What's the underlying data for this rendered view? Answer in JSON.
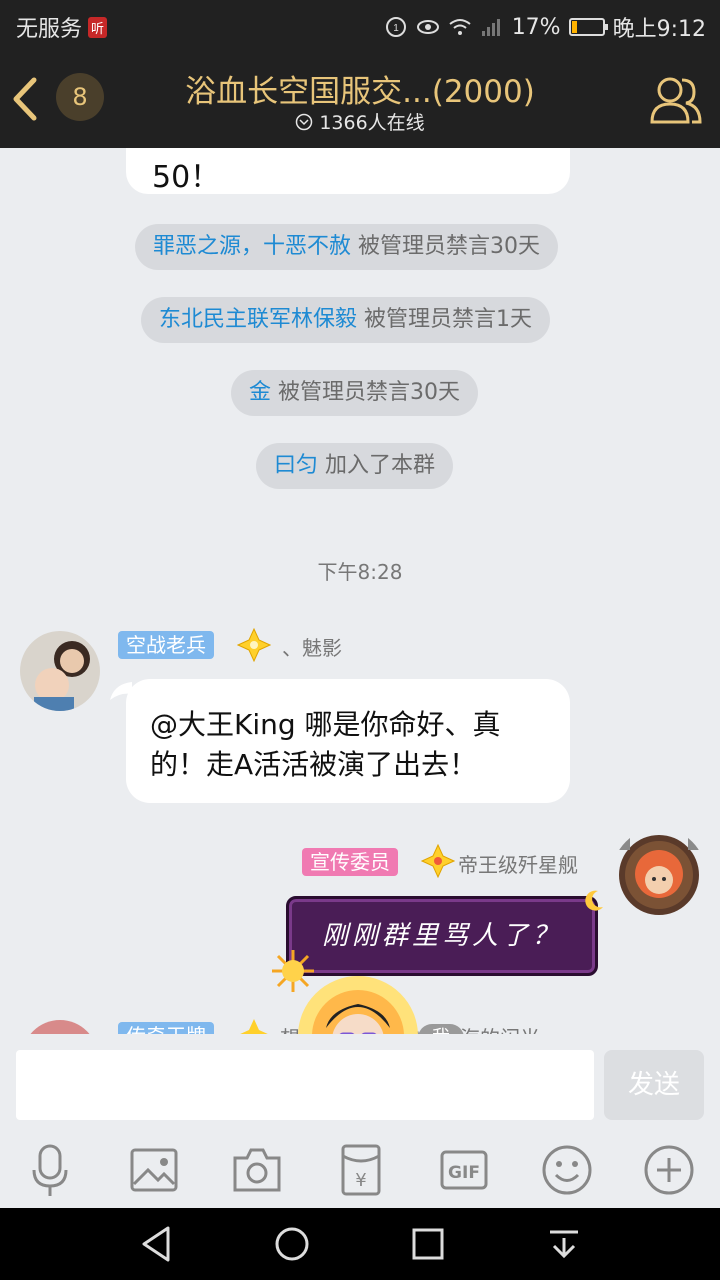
{
  "status_bar": {
    "carrier": "无服务",
    "badge": "听",
    "battery": "17%",
    "time": "晚上9:12",
    "battery_level": 0.17
  },
  "header": {
    "unread": "8",
    "title": "浴血长空国服交...(2000)",
    "online": "1366人在线"
  },
  "chat": {
    "top_bubble_text": "50！",
    "system_messages": [
      {
        "name": "罪恶之源，十恶不赦",
        "text": " 被管理员禁言30天"
      },
      {
        "name": "东北民主联军林保毅",
        "text": " 被管理员禁言1天"
      },
      {
        "name": "金",
        "text": " 被管理员禁言30天"
      },
      {
        "name": "曰匀",
        "text": " 加入了本群"
      }
    ],
    "timestamp": "下午8:28",
    "msg1": {
      "tag": "空战老兵",
      "name": "、魅影",
      "text": "@大王King 哪是你命好、真的！走A活活被演了出去！",
      "tag_color": "#7fb8ee"
    },
    "msg2": {
      "tag": "宣传委员",
      "name": "帝王级歼星舰",
      "text": "刚刚群里骂人了？",
      "tag_color": "#f07ab2"
    },
    "msg3": {
      "tag": "传奇王牌",
      "preview": "想言……谷长的艾桑海的闪光"
    },
    "me_label": "我"
  },
  "input": {
    "placeholder": "",
    "send_label": "发送"
  },
  "toolbar": [
    "mic-icon",
    "image-icon",
    "camera-icon",
    "red-packet-icon",
    "gif-icon",
    "emoji-icon",
    "plus-icon"
  ]
}
